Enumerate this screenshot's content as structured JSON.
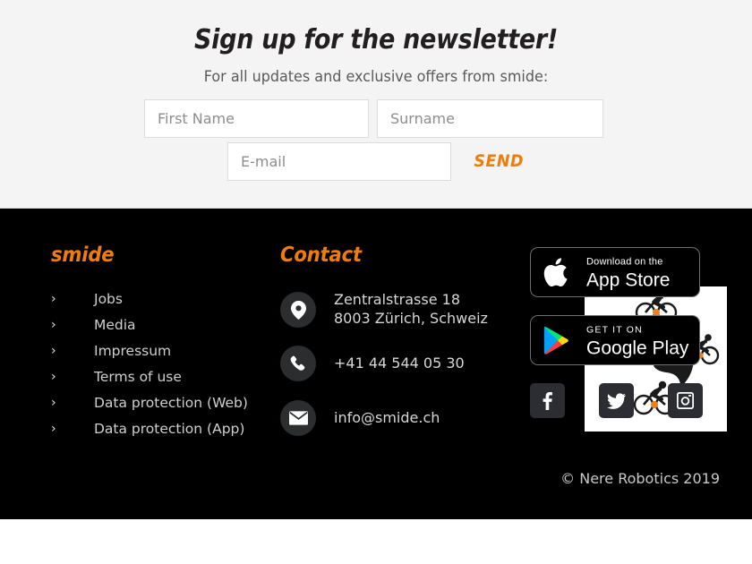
{
  "newsletter": {
    "title": "Sign up for the newsletter!",
    "subtitle": "For all updates and exclusive offers from smide:",
    "fields": [
      {
        "name": "first-name",
        "placeholder": "First Name",
        "value": ""
      },
      {
        "name": "surname",
        "placeholder": "Surname",
        "value": ""
      },
      {
        "name": "email",
        "placeholder": "E-mail",
        "value": ""
      }
    ],
    "send_label": "SEND"
  },
  "footer": {
    "brand_heading": "smide",
    "links": [
      {
        "label": "Jobs",
        "marker": "chevron-right-icon"
      },
      {
        "label": "Media",
        "marker": "chevron-right-icon"
      },
      {
        "label": "Impressum",
        "marker": "chevron-right-icon"
      },
      {
        "label": "Terms of use",
        "marker": "chevron-right-icon"
      },
      {
        "label": "Data protection (Web)",
        "marker": "chevron-right-icon"
      },
      {
        "label": "Data protection (App)",
        "marker": "chevron-right-icon"
      }
    ],
    "contact_heading": "Contact",
    "contact": {
      "address_line1": "Zentralstrasse 18",
      "address_line2": "8003 Zürich, Schweiz",
      "phone": "+41 44 544 05 30",
      "email": "info@smide.ch",
      "icons": {
        "address": "map-pin-icon",
        "phone": "phone-icon",
        "email": "envelope-icon"
      }
    },
    "stores": {
      "apple": {
        "line1": "Download on the",
        "line2": "App Store",
        "icon": "apple-icon"
      },
      "google": {
        "line1": "GET IT ON",
        "line2": "Google Play",
        "icon": "google-play-icon"
      }
    },
    "social": [
      {
        "name": "facebook-icon",
        "label": "Facebook"
      },
      {
        "name": "twitter-icon",
        "label": "Twitter"
      },
      {
        "name": "instagram-icon",
        "label": "Instagram"
      }
    ],
    "copyright": "© Nere Robotics 2019"
  },
  "overlay": {
    "name": "smide-globe-cyclists-logo",
    "description": "globe with four cyclists"
  },
  "colors": {
    "accent_orange": "#f07d0a",
    "footer_bg": "#000000",
    "newsletter_bg": "#f4f4f4",
    "icon_bg": "#2b2d2f",
    "social_bg": "#2b2d33"
  }
}
